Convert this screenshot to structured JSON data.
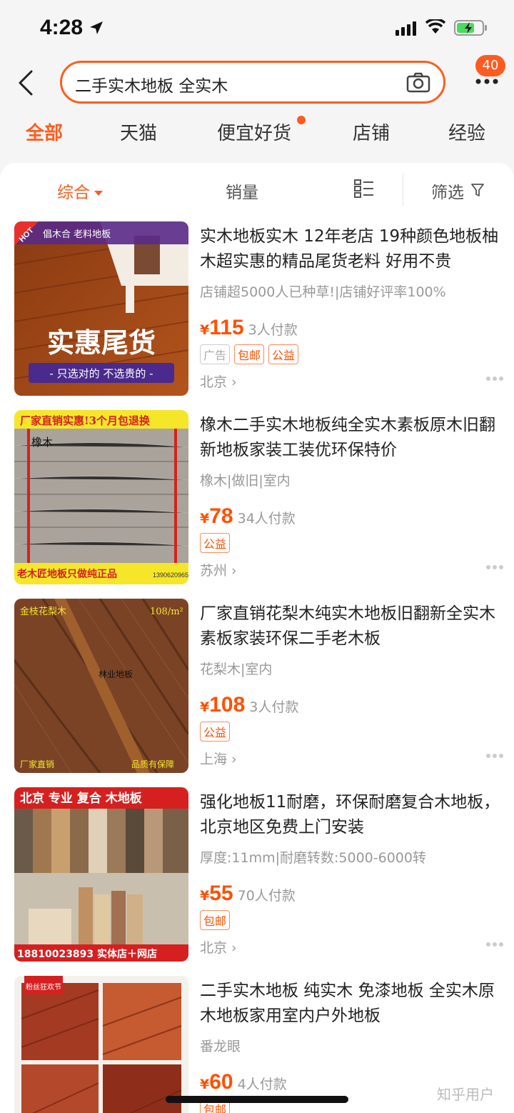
{
  "status": {
    "time": "4:28"
  },
  "search": {
    "query": "二手实木地板 全实木",
    "badge": "40"
  },
  "tabs": [
    {
      "label": "全部"
    },
    {
      "label": "天猫"
    },
    {
      "label": "便宜好货"
    },
    {
      "label": "店铺"
    },
    {
      "label": "经验"
    }
  ],
  "sort": {
    "overall": "综合",
    "sales": "销量",
    "filter": "筛选"
  },
  "products": [
    {
      "title": "实木地板实木 12年老店 19种颜色地板柚木超实惠的精品尾货老料 好用不贵",
      "sub": "店铺超5000人已种草!|店铺好评率100%",
      "yen": "¥",
      "price": "115",
      "paid": "3人付款",
      "tags": [
        "广告",
        "包邮",
        "公益"
      ],
      "location": "北京 ›",
      "img": {
        "hot": "HOT",
        "brand": "倡木合 老料地板",
        "big": "实惠尾货",
        "slogan": "- 只选对的 不选贵的 -"
      }
    },
    {
      "title": "橡木二手实木地板纯全实木素板原木旧翻新地板家装工装优环保特价",
      "sub": "橡木|做旧|室内",
      "yen": "¥",
      "price": "78",
      "paid": "34人付款",
      "tags": [
        "公益"
      ],
      "location": "苏州 ›",
      "img": {
        "top": "厂家直销实惠!3个月包退换",
        "wood": "橡木",
        "bottom": "老木匠地板只做纯正品",
        "phone": "13906209656"
      }
    },
    {
      "title": "厂家直销花梨木纯实木地板旧翻新全实木素板家装环保二手老木板",
      "sub": "花梨木|室内",
      "yen": "¥",
      "price": "108",
      "paid": "3人付款",
      "tags": [
        "公益"
      ],
      "location": "上海 ›",
      "img": {
        "tl": "金枝花梨木",
        "tr": "108/m²",
        "mid": "林业地板",
        "bl": "厂家直销",
        "br": "品质有保障"
      }
    },
    {
      "title": "强化地板11耐磨，环保耐磨复合木地板，北京地区免费上门安装",
      "sub": "厚度:11mm|耐磨转数:5000-6000转",
      "yen": "¥",
      "price": "55",
      "paid": "70人付款",
      "tags": [
        "包邮"
      ],
      "location": "北京 ›",
      "img": {
        "top": "北京 专业 复合 木地板",
        "bottom": "18810023893 实体店＋网店"
      }
    },
    {
      "title": "二手实木地板 纯实木 免漆地板 全实木原木地板家用室内户外地板",
      "sub": "番龙眼",
      "yen": "¥",
      "price": "60",
      "paid": "4人付款",
      "tags": [
        "包邮"
      ],
      "location": "",
      "img": {
        "label": "粉丝狂欢节"
      }
    }
  ],
  "watermark": "知乎用户"
}
